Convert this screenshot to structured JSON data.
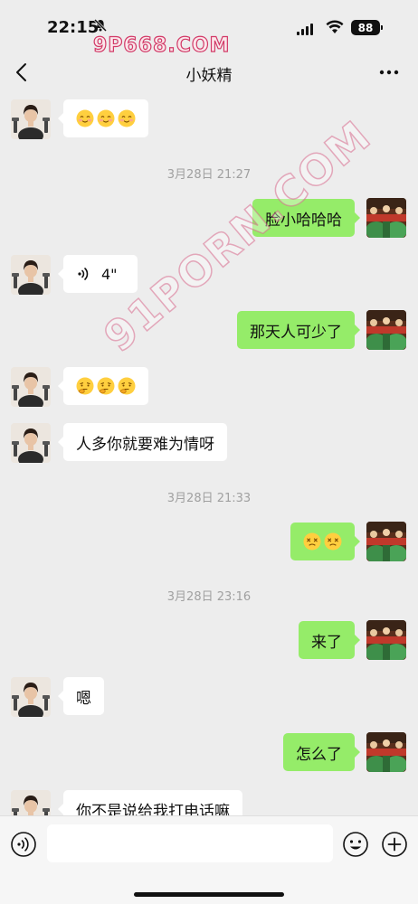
{
  "status_bar": {
    "time": "22:15",
    "battery": "88"
  },
  "watermark": {
    "logo": "9P668.COM",
    "diagonal": "91PORN.COM"
  },
  "header": {
    "title": "小妖精",
    "back_icon": "chevron-left-icon",
    "more_icon": "more-dots-icon"
  },
  "colors": {
    "background": "#ededed",
    "sent_bubble": "#95ec69",
    "received_bubble": "#ffffff",
    "timestamp_text": "#a0a0a0"
  },
  "messages": [
    {
      "side": "left",
      "type": "emoji",
      "emoji": [
        "smile",
        "smile",
        "smile"
      ]
    },
    {
      "type": "timestamp",
      "text": "3月28日 21:27"
    },
    {
      "side": "right",
      "type": "text",
      "text": "脸小哈哈哈"
    },
    {
      "side": "left",
      "type": "voice",
      "duration": "4\""
    },
    {
      "side": "right",
      "type": "text",
      "text": "那天人可少了"
    },
    {
      "side": "left",
      "type": "emoji",
      "emoji": [
        "thinking",
        "thinking",
        "thinking"
      ]
    },
    {
      "side": "left",
      "type": "text",
      "text": "人多你就要难为情呀"
    },
    {
      "type": "timestamp",
      "text": "3月28日 21:33"
    },
    {
      "side": "right",
      "type": "emoji",
      "emoji": [
        "dizzy-face",
        "dizzy-face"
      ]
    },
    {
      "type": "timestamp",
      "text": "3月28日 23:16"
    },
    {
      "side": "right",
      "type": "text",
      "text": "来了"
    },
    {
      "side": "left",
      "type": "text",
      "text": "嗯"
    },
    {
      "side": "right",
      "type": "text",
      "text": "怎么了"
    },
    {
      "side": "left",
      "type": "text",
      "text": "你不是说给我打电话嘛"
    }
  ],
  "input_bar": {
    "voice_icon": "voice-mode-icon",
    "placeholder": "",
    "emoji_icon": "emoji-picker-icon",
    "plus_icon": "plus-circle-icon"
  }
}
